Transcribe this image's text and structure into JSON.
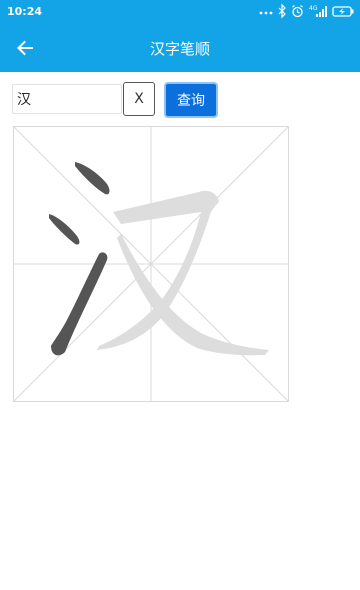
{
  "status_bar": {
    "time": "10:24",
    "icons": [
      "dots-icon",
      "bluetooth-icon",
      "alarm-icon",
      "signal-4g-icon",
      "battery-charging-icon"
    ]
  },
  "app_bar": {
    "title": "汉字笔顺",
    "back_icon": "arrow-left-icon"
  },
  "search": {
    "value": "汉",
    "clear_label": "X",
    "query_label": "查询"
  },
  "stroke_display": {
    "character": "汉",
    "total_strokes": 5,
    "completed_strokes": 3,
    "completed_color": "#555555",
    "pending_color": "#dddddd",
    "grid_color": "#d9d9d9"
  },
  "colors": {
    "accent": "#12a4e6",
    "button": "#0d6fdc"
  }
}
